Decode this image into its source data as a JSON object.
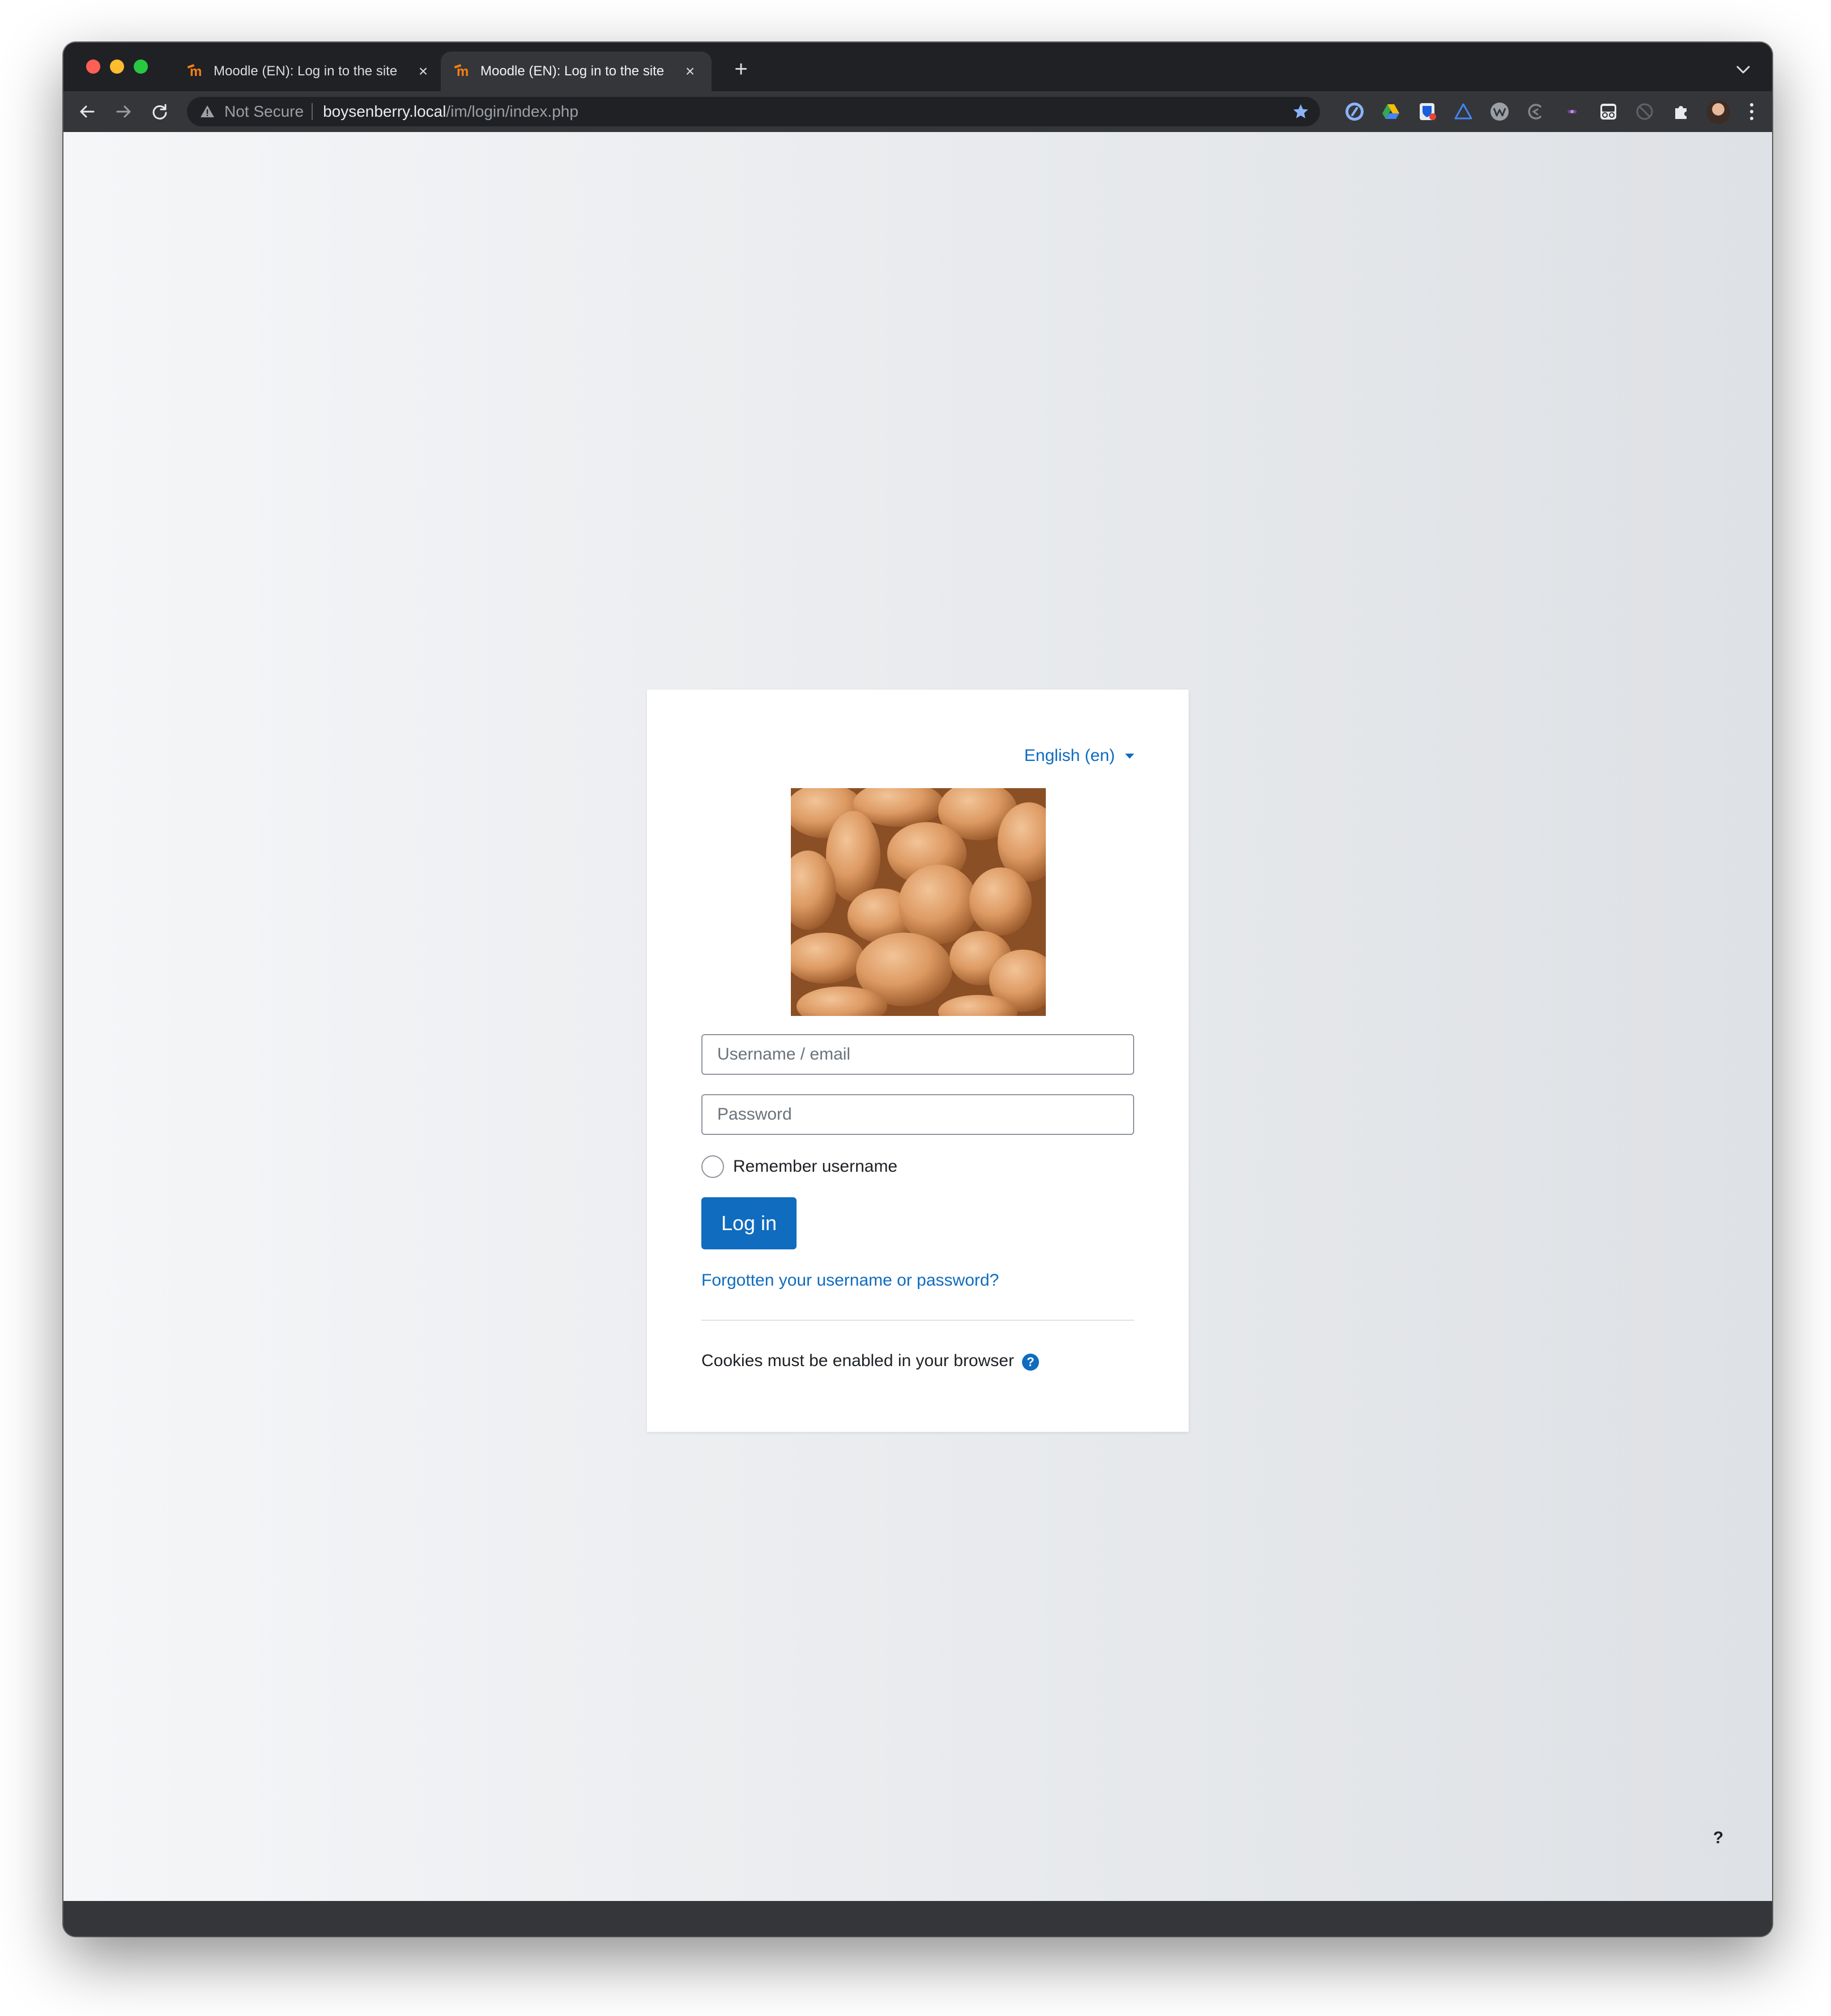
{
  "browser": {
    "tabs": [
      {
        "title": "Moodle (EN): Log in to the site",
        "active": false
      },
      {
        "title": "Moodle (EN): Log in to the site",
        "active": true
      }
    ],
    "address_bar": {
      "security_label": "Not Secure",
      "host": "boysenberry.local",
      "path": "/im/login/index.php"
    },
    "extensions": [
      "1password-icon",
      "google-drive-icon",
      "bitwarden-icon",
      "triangle-extension-icon",
      "wappalyzer-icon",
      "grammar-extension-icon",
      "dot-extension-icon",
      "glasses-extension-icon",
      "grayscale-extension-icon",
      "puzzle-icon"
    ]
  },
  "login": {
    "language_selector": "English (en)",
    "logo_alt": "potatoes",
    "username_placeholder": "Username / email",
    "password_placeholder": "Password",
    "remember_label": "Remember username",
    "login_button": "Log in",
    "forgot_link": "Forgotten your username or password?",
    "cookies_notice": "Cookies must be enabled in your browser"
  },
  "page": {
    "help_button": "?"
  },
  "colors": {
    "brand": "#0f6cbf",
    "moodle_orange": "#f98012"
  }
}
